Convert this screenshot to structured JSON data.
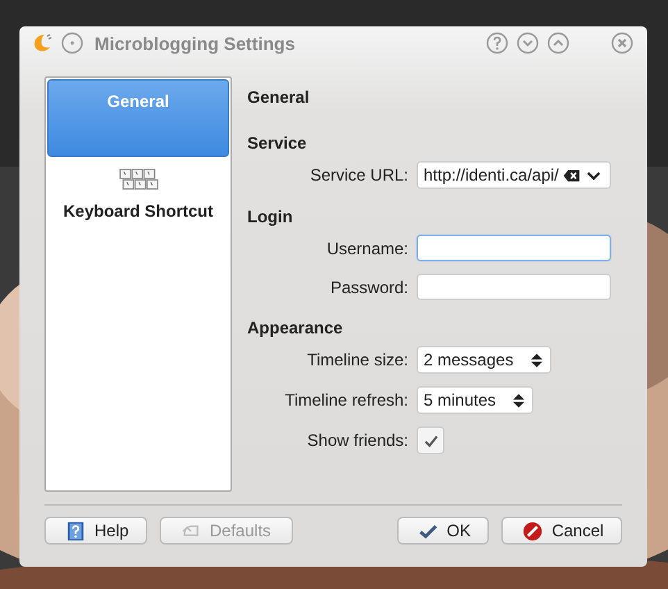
{
  "window": {
    "title": "Microblogging Settings"
  },
  "pages": [
    {
      "label": "General",
      "selected": true,
      "kind": "general"
    },
    {
      "label": "Keyboard Shortcut",
      "selected": false,
      "kind": "keyboard"
    }
  ],
  "page_title": "General",
  "sections": [
    {
      "title": "Service",
      "fields": [
        {
          "kind": "combo-edit",
          "label": "Service URL:",
          "value": "http://identi.ca/api/"
        }
      ]
    },
    {
      "title": "Login",
      "fields": [
        {
          "kind": "text",
          "label": "Username:",
          "focused": true
        },
        {
          "kind": "text",
          "label": "Password:",
          "focused": false
        }
      ]
    },
    {
      "title": "Appearance",
      "fields": [
        {
          "kind": "spin",
          "label": "Timeline size:",
          "value": "2 messages"
        },
        {
          "kind": "spin",
          "label": "Timeline refresh:",
          "value": "5 minutes"
        },
        {
          "kind": "checkbox",
          "label": "Show friends:",
          "checked": true
        }
      ]
    }
  ],
  "buttons": [
    {
      "kind": "help",
      "label": "Help",
      "disabled": false
    },
    {
      "kind": "defaults",
      "label": "Defaults",
      "disabled": true
    },
    {
      "kind": "ok",
      "label": "OK",
      "disabled": false
    },
    {
      "kind": "cancel",
      "label": "Cancel",
      "disabled": false
    }
  ]
}
